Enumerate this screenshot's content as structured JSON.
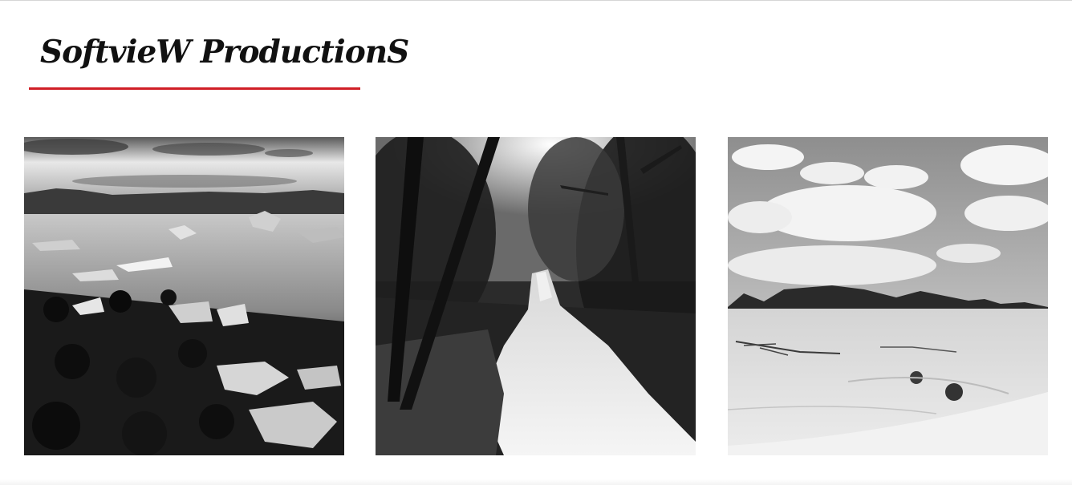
{
  "header": {
    "logo_text": "SoftvieW ProductionS",
    "accent_color": "#d01f26"
  },
  "gallery": {
    "photos": [
      {
        "subject": "glacier lagoon with ice chunks on black stone beach",
        "tone": "black-and-white"
      },
      {
        "subject": "forest waterfall between trees",
        "tone": "black-and-white"
      },
      {
        "subject": "sand dunes with mountains and cloudy sky",
        "tone": "black-and-white"
      }
    ]
  }
}
